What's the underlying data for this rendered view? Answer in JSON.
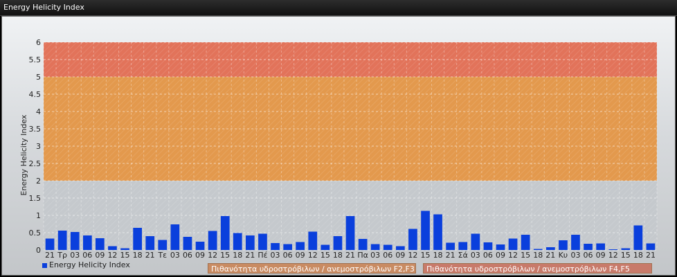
{
  "window": {
    "title": "Energy Helicity Index"
  },
  "chart_data": {
    "type": "bar",
    "title": "",
    "ylabel": "Energy Helicity Index",
    "xlabel": "",
    "ylim": [
      0,
      6
    ],
    "yticks": [
      "0",
      "0.5",
      "1",
      "1.5",
      "2",
      "2.5",
      "3",
      "3.5",
      "4",
      "4.5",
      "5",
      "5.5",
      "6"
    ],
    "grid": true,
    "legend_position": "bottom-left",
    "bar_color": "#0a3fdc",
    "bands": [
      {
        "from": 2,
        "to": 5,
        "color": "#e3994d",
        "label": "Πιθανότητα υδροστρόβιλων / ανεμοστρόβιλων F2,F3"
      },
      {
        "from": 5,
        "to": 6,
        "color": "#e2735a",
        "label": "Πιθανότητα υδροστρόβιλων / ανεμοστρόβιλων F4,F5"
      }
    ],
    "categories": [
      "21",
      "Τρ",
      "03",
      "06",
      "09",
      "12",
      "15",
      "18",
      "21",
      "Τε",
      "03",
      "06",
      "09",
      "12",
      "15",
      "18",
      "21",
      "Πέ",
      "03",
      "06",
      "09",
      "12",
      "15",
      "18",
      "21",
      "Πα",
      "03",
      "06",
      "09",
      "12",
      "15",
      "18",
      "21",
      "Σά",
      "03",
      "06",
      "09",
      "12",
      "15",
      "18",
      "21",
      "Κυ",
      "03",
      "06",
      "09",
      "12",
      "15",
      "18",
      "21"
    ],
    "series": [
      {
        "name": "Energy Helicity Index",
        "values": [
          0.33,
          0.56,
          0.52,
          0.42,
          0.34,
          0.11,
          0.05,
          0.64,
          0.4,
          0.29,
          0.74,
          0.38,
          0.24,
          0.55,
          0.98,
          0.49,
          0.42,
          0.47,
          0.2,
          0.17,
          0.23,
          0.53,
          0.15,
          0.4,
          0.98,
          0.32,
          0.17,
          0.15,
          0.11,
          0.61,
          1.13,
          1.03,
          0.21,
          0.23,
          0.47,
          0.22,
          0.16,
          0.33,
          0.44,
          0.03,
          0.08,
          0.28,
          0.44,
          0.18,
          0.19,
          0.02,
          0.05,
          0.71,
          0.19
        ]
      }
    ]
  }
}
